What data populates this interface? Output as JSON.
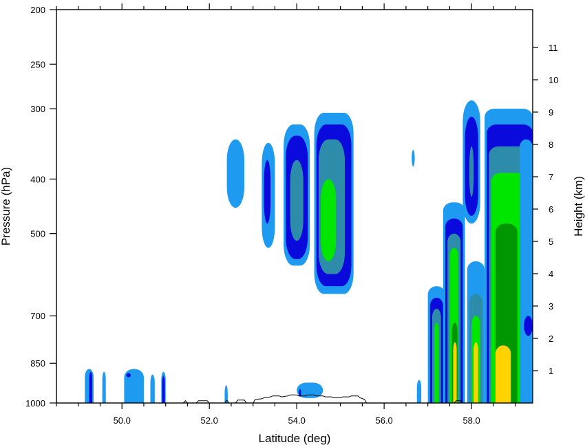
{
  "chart_data": {
    "type": "contour",
    "xlabel": "Latitude (deg)",
    "ylabel_left": "Pressure (hPa)",
    "ylabel_right": "Height (km)",
    "xlim": [
      48.5,
      59.4
    ],
    "x_ticks": [
      50.0,
      52.0,
      54.0,
      56.0,
      58.0
    ],
    "x_tick_labels": [
      "50.0",
      "52.0",
      "54.0",
      "56.0",
      "58.0"
    ],
    "ylim_pressure": [
      1000,
      200
    ],
    "y_scale": "log",
    "pressure_ticks": [
      200,
      250,
      300,
      400,
      500,
      700,
      850,
      1000
    ],
    "pressure_tick_labels": [
      "200",
      "250",
      "300",
      "400",
      "500",
      "700",
      "850",
      "1000"
    ],
    "height_ticks": [
      1,
      2,
      3,
      4,
      5,
      6,
      7,
      8,
      9,
      10,
      11
    ],
    "height_tick_labels": [
      "1",
      "2",
      "3",
      "4",
      "5",
      "6",
      "7",
      "8",
      "9",
      "10",
      "11"
    ],
    "levels": [
      {
        "level": 1,
        "color": "#1e9bf0"
      },
      {
        "level": 2,
        "color": "#0a0adc"
      },
      {
        "level": 3,
        "color": "#2d8caa"
      },
      {
        "level": 4,
        "color": "#00e600"
      },
      {
        "level": 5,
        "color": "#009600"
      },
      {
        "level": 6,
        "color": "#ffd200"
      }
    ],
    "features": [
      {
        "name": "cell-52.7",
        "bands": [
          {
            "level": 1,
            "xmin": 52.4,
            "xmax": 52.8,
            "p_top": 340,
            "p_bot": 450
          }
        ]
      },
      {
        "name": "cell-53.3",
        "bands": [
          {
            "level": 1,
            "xmin": 53.2,
            "xmax": 53.5,
            "p_top": 345,
            "p_bot": 530
          },
          {
            "level": 2,
            "xmin": 53.25,
            "xmax": 53.4,
            "p_top": 370,
            "p_bot": 480
          }
        ]
      },
      {
        "name": "cell-54.0",
        "bands": [
          {
            "level": 1,
            "xmin": 53.7,
            "xmax": 54.3,
            "p_top": 320,
            "p_bot": 570
          },
          {
            "level": 2,
            "xmin": 53.75,
            "xmax": 54.25,
            "p_top": 335,
            "p_bot": 555
          },
          {
            "level": 3,
            "xmin": 53.85,
            "xmax": 54.15,
            "p_top": 370,
            "p_bot": 515
          }
        ]
      },
      {
        "name": "cell-54.8",
        "bands": [
          {
            "level": 1,
            "xmin": 54.4,
            "xmax": 55.3,
            "p_top": 305,
            "p_bot": 640
          },
          {
            "level": 2,
            "xmin": 54.45,
            "xmax": 55.25,
            "p_top": 320,
            "p_bot": 620
          },
          {
            "level": 3,
            "xmin": 54.5,
            "xmax": 55.1,
            "p_top": 340,
            "p_bot": 590
          },
          {
            "level": 4,
            "xmin": 54.55,
            "xmax": 54.9,
            "p_top": 400,
            "p_bot": 560
          }
        ]
      },
      {
        "name": "cell-56.7",
        "bands": [
          {
            "level": 1,
            "xmin": 56.63,
            "xmax": 56.7,
            "p_top": 355,
            "p_bot": 380
          }
        ]
      },
      {
        "name": "cell-58.0-upper",
        "bands": [
          {
            "level": 1,
            "xmin": 57.8,
            "xmax": 58.2,
            "p_top": 290,
            "p_bot": 480
          },
          {
            "level": 2,
            "xmin": 57.85,
            "xmax": 58.15,
            "p_top": 310,
            "p_bot": 465
          },
          {
            "level": 3,
            "xmin": 57.95,
            "xmax": 58.05,
            "p_top": 350,
            "p_bot": 430
          }
        ]
      },
      {
        "name": "cell-58.7-main",
        "bands": [
          {
            "level": 1,
            "xmin": 58.3,
            "xmax": 59.4,
            "p_top": 300,
            "p_bot": 1000
          },
          {
            "level": 2,
            "xmin": 58.35,
            "xmax": 59.4,
            "p_top": 320,
            "p_bot": 1000
          },
          {
            "level": 3,
            "xmin": 58.4,
            "xmax": 59.3,
            "p_top": 350,
            "p_bot": 1000
          },
          {
            "level": 4,
            "xmin": 58.45,
            "xmax": 59.25,
            "p_top": 390,
            "p_bot": 1000
          },
          {
            "level": 5,
            "xmin": 58.55,
            "xmax": 59.05,
            "p_top": 480,
            "p_bot": 1000
          },
          {
            "level": 6,
            "xmin": 58.55,
            "xmax": 58.9,
            "p_top": 790,
            "p_bot": 1000
          }
        ]
      },
      {
        "name": "cell-57.3-left",
        "bands": [
          {
            "level": 1,
            "xmin": 57.0,
            "xmax": 57.4,
            "p_top": 620,
            "p_bot": 1000
          },
          {
            "level": 2,
            "xmin": 57.05,
            "xmax": 57.35,
            "p_top": 650,
            "p_bot": 1000
          },
          {
            "level": 3,
            "xmin": 57.1,
            "xmax": 57.3,
            "p_top": 680,
            "p_bot": 1000
          },
          {
            "level": 4,
            "xmin": 57.15,
            "xmax": 57.25,
            "p_top": 720,
            "p_bot": 1000
          }
        ]
      },
      {
        "name": "cell-57.7",
        "bands": [
          {
            "level": 1,
            "xmin": 57.35,
            "xmax": 57.85,
            "p_top": 440,
            "p_bot": 1000
          },
          {
            "level": 2,
            "xmin": 57.4,
            "xmax": 57.8,
            "p_top": 470,
            "p_bot": 1000
          },
          {
            "level": 3,
            "xmin": 57.45,
            "xmax": 57.75,
            "p_top": 500,
            "p_bot": 1000
          },
          {
            "level": 4,
            "xmin": 57.5,
            "xmax": 57.7,
            "p_top": 530,
            "p_bot": 1000
          },
          {
            "level": 5,
            "xmin": 57.55,
            "xmax": 57.68,
            "p_top": 720,
            "p_bot": 1000
          },
          {
            "level": 6,
            "xmin": 57.58,
            "xmax": 57.66,
            "p_top": 780,
            "p_bot": 1000
          }
        ]
      },
      {
        "name": "cell-58.1-lower",
        "bands": [
          {
            "level": 1,
            "xmin": 57.9,
            "xmax": 58.3,
            "p_top": 560,
            "p_bot": 1000
          },
          {
            "level": 3,
            "xmin": 57.95,
            "xmax": 58.25,
            "p_top": 640,
            "p_bot": 1000
          },
          {
            "level": 4,
            "xmin": 58.0,
            "xmax": 58.2,
            "p_top": 700,
            "p_bot": 1000
          },
          {
            "level": 6,
            "xmin": 58.05,
            "xmax": 58.15,
            "p_top": 780,
            "p_bot": 1000
          }
        ]
      },
      {
        "name": "cell-59.2-right",
        "bands": [
          {
            "level": 1,
            "xmin": 59.1,
            "xmax": 59.4,
            "p_top": 340,
            "p_bot": 1000
          },
          {
            "level": 2,
            "xmin": 59.2,
            "xmax": 59.4,
            "p_top": 700,
            "p_bot": 760
          }
        ]
      },
      {
        "name": "low-49.2",
        "bands": [
          {
            "level": 1,
            "xmin": 49.15,
            "xmax": 49.35,
            "p_top": 870,
            "p_bot": 1000
          },
          {
            "level": 2,
            "xmin": 49.25,
            "xmax": 49.32,
            "p_top": 880,
            "p_bot": 1000
          }
        ]
      },
      {
        "name": "low-49.6",
        "bands": [
          {
            "level": 1,
            "xmin": 49.55,
            "xmax": 49.63,
            "p_top": 880,
            "p_bot": 1000
          }
        ]
      },
      {
        "name": "low-50.2",
        "bands": [
          {
            "level": 1,
            "xmin": 50.05,
            "xmax": 50.5,
            "p_top": 870,
            "p_bot": 1000
          },
          {
            "level": 2,
            "xmin": 50.1,
            "xmax": 50.2,
            "p_top": 885,
            "p_bot": 900
          }
        ]
      },
      {
        "name": "low-50.8",
        "bands": [
          {
            "level": 1,
            "xmin": 50.65,
            "xmax": 50.75,
            "p_top": 890,
            "p_bot": 1000
          },
          {
            "level": 1,
            "xmin": 50.9,
            "xmax": 51.0,
            "p_top": 880,
            "p_bot": 1000
          },
          {
            "level": 2,
            "xmin": 50.92,
            "xmax": 50.98,
            "p_top": 895,
            "p_bot": 1000
          }
        ]
      },
      {
        "name": "low-52.4",
        "bands": [
          {
            "level": 1,
            "xmin": 52.35,
            "xmax": 52.42,
            "p_top": 930,
            "p_bot": 1000
          }
        ]
      },
      {
        "name": "low-54.2",
        "bands": [
          {
            "level": 1,
            "xmin": 54.0,
            "xmax": 54.6,
            "p_top": 920,
            "p_bot": 980
          },
          {
            "level": 2,
            "xmin": 54.05,
            "xmax": 54.1,
            "p_top": 945,
            "p_bot": 975
          }
        ]
      },
      {
        "name": "low-56.8",
        "bands": [
          {
            "level": 1,
            "xmin": 56.75,
            "xmax": 56.85,
            "p_top": 910,
            "p_bot": 1000
          }
        ]
      }
    ],
    "terrain": {
      "latitudes": [
        51.4,
        51.45,
        51.5,
        51.7,
        51.75,
        51.95,
        52.0,
        52.35,
        52.4,
        52.45,
        52.6,
        52.65,
        52.8,
        52.85,
        53.0,
        53.05,
        53.2,
        53.25,
        53.4,
        53.45,
        53.6,
        53.65,
        53.8,
        53.85,
        54.0,
        54.05,
        54.2,
        54.25,
        54.4,
        54.45,
        54.6,
        54.65,
        54.8,
        54.85,
        55.0,
        55.05,
        55.2,
        55.25,
        55.4,
        55.45,
        55.55,
        55.6
      ],
      "heights_m": [
        0,
        70,
        0,
        0,
        70,
        70,
        0,
        0,
        90,
        0,
        0,
        90,
        90,
        0,
        0,
        110,
        130,
        160,
        190,
        220,
        220,
        190,
        220,
        250,
        250,
        220,
        220,
        250,
        250,
        220,
        220,
        190,
        190,
        160,
        160,
        190,
        190,
        220,
        220,
        160,
        110,
        0
      ]
    },
    "terrain_2": {
      "latitudes": [
        57.6,
        57.65,
        57.75,
        57.8
      ],
      "heights_m": [
        0,
        70,
        70,
        0
      ]
    }
  }
}
